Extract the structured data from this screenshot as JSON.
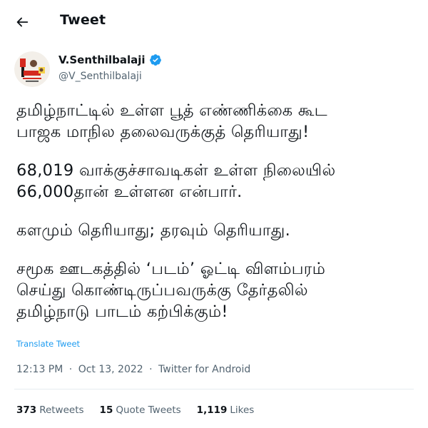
{
  "header": {
    "title": "Tweet"
  },
  "author": {
    "name": "V.Senthilbalaji",
    "handle": "@V_Senthilbalaji"
  },
  "tweet": {
    "paragraphs": [
      "தமிழ்நாட்டில் உள்ள பூத் எண்ணிக்கை கூட\nபாஜக மாநில தலைவருக்குத் தெரியாது!",
      "68,019 வாக்குச்சாவடிகள் உள்ள நிலையில்\n66,000தான் உள்ளன என்பார்.",
      "களமும் தெரியாது; தரவும் தெரியாது.",
      "சமூக ஊடகத்தில் ‘படம்’ ஓட்டி விளம்பரம்\nசெய்து கொண்டிருப்பவருக்கு தேர்தலில்\nதமிழ்நாடு பாடம் கற்பிக்கும்!"
    ],
    "translate_label": "Translate Tweet",
    "time": "12:13 PM",
    "date": "Oct 13, 2022",
    "dot": "·",
    "source": "Twitter for Android"
  },
  "stats": {
    "retweets_count": "373",
    "retweets_label": "Retweets",
    "quotes_count": "15",
    "quotes_label": "Quote Tweets",
    "likes_count": "1,119",
    "likes_label": "Likes"
  },
  "colors": {
    "accent": "#1d9bf0",
    "secondary_text": "#536471",
    "divider": "#e6ecf0"
  }
}
